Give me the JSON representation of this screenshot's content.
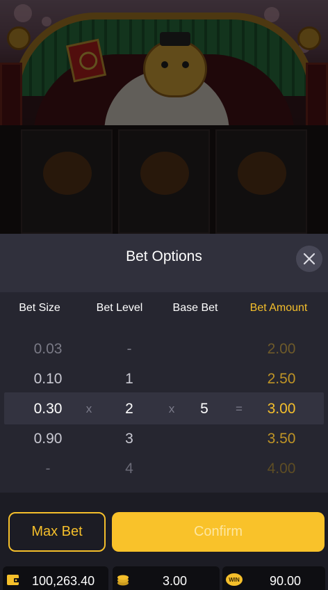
{
  "modal": {
    "title": "Bet Options",
    "close_icon": "close-icon"
  },
  "columns": {
    "bet_size": "Bet Size",
    "bet_level": "Bet Level",
    "base_bet": "Base Bet",
    "bet_amount": "Bet Amount"
  },
  "rows": [
    {
      "size": "0.03",
      "level": "-",
      "amount": "2.00"
    },
    {
      "size": "0.10",
      "level": "1",
      "amount": "2.50"
    },
    {
      "size": "0.30",
      "level": "2",
      "amount": "3.00"
    },
    {
      "size": "0.90",
      "level": "3",
      "amount": "3.50"
    },
    {
      "size": "-",
      "level": "4",
      "amount": "4.00"
    }
  ],
  "selected": {
    "size": "0.30",
    "op_times_1": "x",
    "level": "2",
    "op_times_2": "x",
    "base": "5",
    "op_equals": "=",
    "amount": "3.00"
  },
  "buttons": {
    "max_bet": "Max Bet",
    "confirm": "Confirm"
  },
  "status_bar": {
    "balance": "100,263.40",
    "bet": "3.00",
    "win": "90.00",
    "win_icon_text": "WIN",
    "balance_icon": "wallet-icon",
    "bet_icon": "coins-icon",
    "win_icon": "win-badge-icon"
  },
  "colors": {
    "accent": "#f5bf2b",
    "confirm": "#f9c22a",
    "panel": "#262630",
    "header": "#30303c"
  }
}
